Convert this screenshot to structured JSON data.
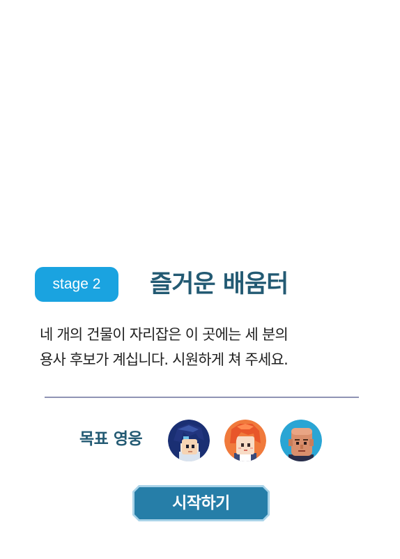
{
  "stage": {
    "badge_label": "stage 2",
    "title": "즐거운 배움터"
  },
  "description": {
    "line1": "네 개의 건물이 자리잡은 이 곳에는 세 분의",
    "line2": "용사 후보가 계십니다. 시원하게 쳐 주세요."
  },
  "goal": {
    "label": "목표 영웅",
    "heroes": [
      {
        "icon": "hero-blue-hair-avatar"
      },
      {
        "icon": "hero-orange-hair-avatar"
      },
      {
        "icon": "hero-bald-avatar"
      }
    ]
  },
  "start_button": {
    "label": "시작하기"
  },
  "colors": {
    "badge_bg": "#1aa3e0",
    "title": "#235a73",
    "button_bg": "#267ea8",
    "button_border": "#a9d3e8",
    "divider": "#8f93b4"
  }
}
